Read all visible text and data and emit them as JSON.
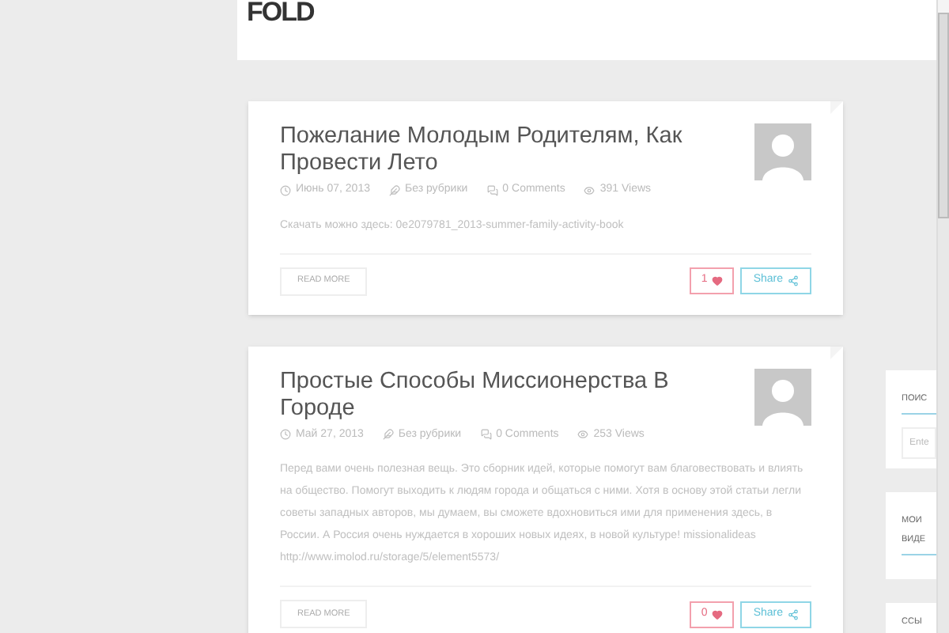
{
  "header": {
    "logo": "FOLD"
  },
  "posts": [
    {
      "title": "Пожелание Молодым Родителям, Как Провести Лето",
      "date": "Июнь 07, 2013",
      "category": "Без рубрики",
      "comments": "0 Comments",
      "views": "391 Views",
      "excerpt": "Скачать можно здесь: 0e2079781_2013-summer-family-activity-book",
      "read_more": "READ MORE",
      "likes": "1",
      "share": "Share"
    },
    {
      "title": "Простые Способы Миссионерства В Городе",
      "date": "Май 27, 2013",
      "category": "Без рубрики",
      "comments": "0 Comments",
      "views": "253 Views",
      "excerpt": "Перед вами очень полезная вещь. Это сборник идей, которые помогут вам благовествовать и влиять на общество. Помогут выходить к людям города и общаться с ними. Хотя в основу этой статьи легли советы западных авторов, мы думаем, вы сможете вдохновиться ими для применения здесь, в России. А Россия очень нуждается в хороших новых идеях, в новой культуре! missionalideas   http://www.imolod.ru/storage/5/element5573/",
      "read_more": "READ MORE",
      "likes": "0",
      "share": "Share"
    }
  ],
  "sidebar": [
    {
      "kind": "search",
      "title": "ПОИС",
      "placeholder": "Ente"
    },
    {
      "kind": "list",
      "title": "МОИ ВИДЕ"
    },
    {
      "kind": "list",
      "title": "ССЫ"
    }
  ]
}
